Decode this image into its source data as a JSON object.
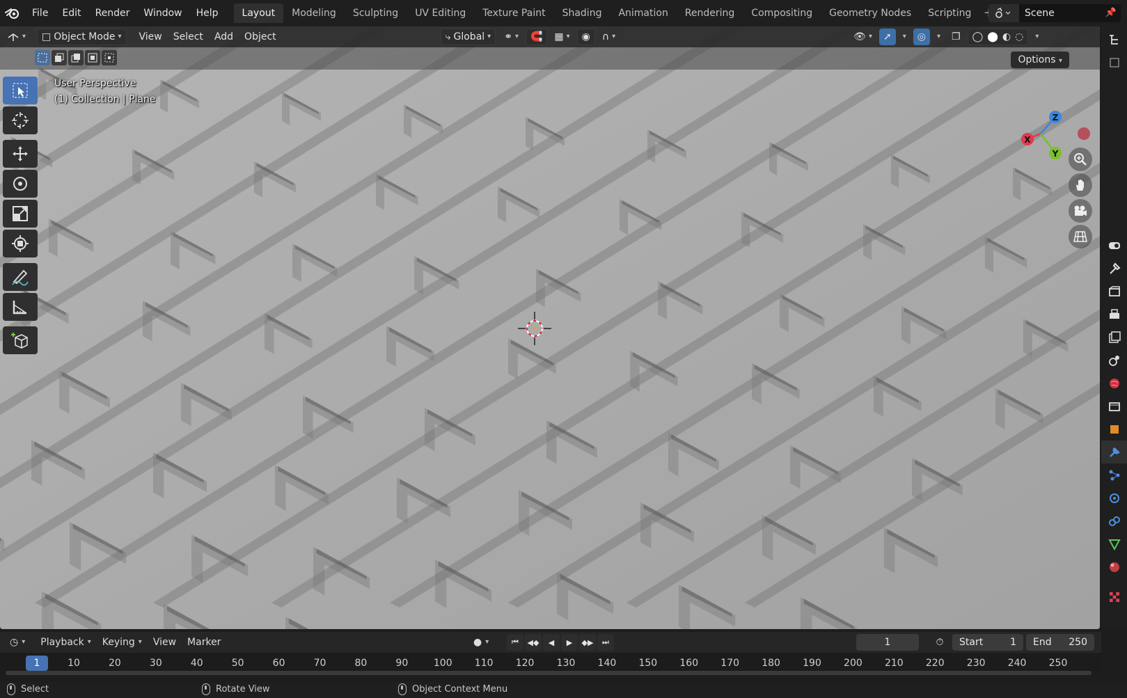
{
  "app_menu": [
    "File",
    "Edit",
    "Render",
    "Window",
    "Help"
  ],
  "workspaces": [
    "Layout",
    "Modeling",
    "Sculpting",
    "UV Editing",
    "Texture Paint",
    "Shading",
    "Animation",
    "Rendering",
    "Compositing",
    "Geometry Nodes",
    "Scripting"
  ],
  "active_workspace": "Layout",
  "scene": {
    "label": "Scene"
  },
  "viewport_header": {
    "mode": "Object Mode",
    "menus": [
      "View",
      "Select",
      "Add",
      "Object"
    ],
    "transform_orientation": "Global",
    "options": "Options"
  },
  "viewport_overlay": {
    "perspective": "User Perspective",
    "collection": "(1) Collection | Plane"
  },
  "gizmo": {
    "x": "X",
    "y": "Y",
    "z": "Z"
  },
  "timeline": {
    "menus": [
      "Playback",
      "Keying",
      "View",
      "Marker"
    ],
    "current_frame": "1",
    "start_label": "Start",
    "start_value": "1",
    "end_label": "End",
    "end_value": "250",
    "ruler": [
      "1",
      "10",
      "20",
      "30",
      "40",
      "50",
      "60",
      "70",
      "80",
      "90",
      "100",
      "110",
      "120",
      "130",
      "140",
      "150",
      "160",
      "170",
      "180",
      "190",
      "200",
      "210",
      "220",
      "230",
      "240",
      "250"
    ]
  },
  "statusbar": {
    "select": "Select",
    "rotate": "Rotate View",
    "context": "Object Context Menu"
  },
  "colors": {
    "accent": "#4772b3",
    "axis_x": "#e0394e",
    "axis_y": "#7bbf2a",
    "axis_z": "#3b86e0"
  }
}
